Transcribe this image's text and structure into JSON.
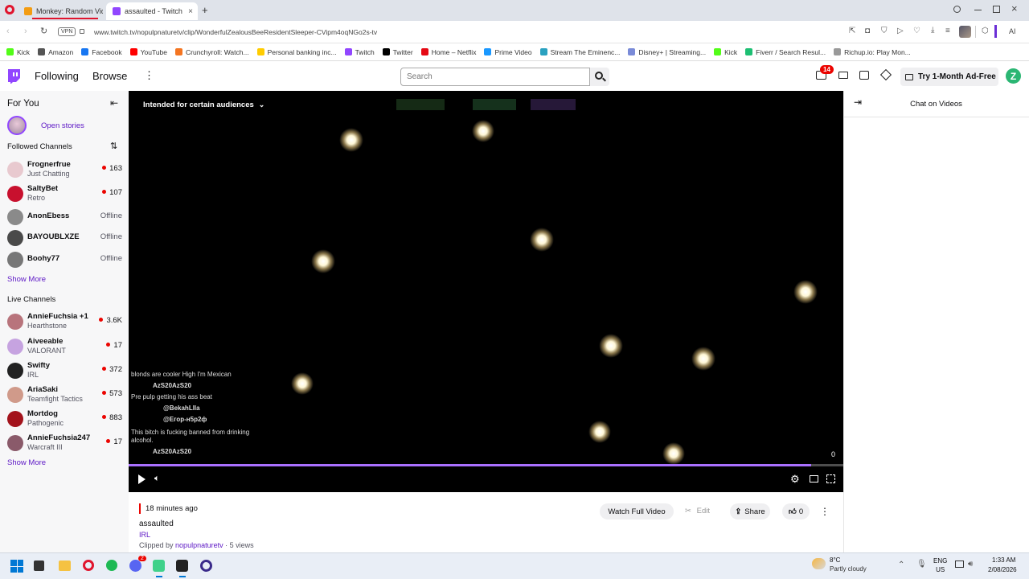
{
  "browser": {
    "tabs": [
      {
        "label": "Monkey: Random Vid"
      },
      {
        "label": "assaulted - Twitch"
      }
    ],
    "new_tab": "+",
    "url": "www.twitch.tv/nopulpnaturetv/clip/WonderfulZealousBeeResidentSleeper-CVipm4oqNGo2s-tv",
    "vpn": "VPN",
    "ai": "AI",
    "bookmarks": [
      {
        "label": "Kick",
        "color": "#53fc18"
      },
      {
        "label": "Amazon",
        "color": "#555555"
      },
      {
        "label": "Facebook",
        "color": "#1877f2"
      },
      {
        "label": "YouTube",
        "color": "#ff0000"
      },
      {
        "label": "Crunchyroll: Watch...",
        "color": "#f47521"
      },
      {
        "label": "Personal banking inc...",
        "color": "#ffcc00"
      },
      {
        "label": "Twitch",
        "color": "#9146ff"
      },
      {
        "label": "Twitter",
        "color": "#000000"
      },
      {
        "label": "Home – Netflix",
        "color": "#e50914"
      },
      {
        "label": "Prime Video",
        "color": "#1a98ff"
      },
      {
        "label": "Stream The Eminenc...",
        "color": "#2aa1c0"
      },
      {
        "label": "Disney+ | Streaming...",
        "color": "#7a8bd8"
      },
      {
        "label": "Kick",
        "color": "#53fc18"
      },
      {
        "label": "Fiverr / Search Resul...",
        "color": "#1dbf73"
      },
      {
        "label": "Richup.io: Play Mon...",
        "color": "#999999"
      }
    ]
  },
  "header": {
    "following": "Following",
    "browse": "Browse",
    "search_placeholder": "Search",
    "notif_count": "14",
    "ad_free": "Try 1-Month Ad-Free",
    "user_initial": "Z"
  },
  "sidebar": {
    "for_you": "For You",
    "open_stories": "Open stories",
    "followed_title": "Followed Channels",
    "followed": [
      {
        "name": "Frognerfrue",
        "game": "Just Chatting",
        "viewers": "163",
        "live": true,
        "color": "#e8c9cf"
      },
      {
        "name": "SaltyBet",
        "game": "Retro",
        "viewers": "107",
        "live": true,
        "color": "#c8102e"
      },
      {
        "name": "AnonEbess",
        "game": "",
        "viewers": "Offline",
        "live": false,
        "color": "#8a8a8a"
      },
      {
        "name": "BAYOUBLXZE",
        "game": "",
        "viewers": "Offline",
        "live": false,
        "color": "#4a4a4a"
      },
      {
        "name": "Boohy77",
        "game": "",
        "viewers": "Offline",
        "live": false,
        "color": "#777777"
      }
    ],
    "show_more_1": "Show More",
    "live_title": "Live Channels",
    "live": [
      {
        "name": "AnnieFuchsia +1",
        "game": "Hearthstone",
        "viewers": "3.6K",
        "color": "#b8747c"
      },
      {
        "name": "Aiveeable",
        "game": "VALORANT",
        "viewers": "17",
        "color": "#c6a3e0"
      },
      {
        "name": "Swifty",
        "game": "IRL",
        "viewers": "372",
        "color": "#222222"
      },
      {
        "name": "AriaSaki",
        "game": "Teamfight Tactics",
        "viewers": "573",
        "color": "#d09a8a"
      },
      {
        "name": "Mortdog",
        "game": "Pathogenic",
        "viewers": "883",
        "color": "#a3131c"
      },
      {
        "name": "AnnieFuchsia247",
        "game": "Warcraft III",
        "viewers": "17",
        "color": "#8a5a6a"
      }
    ],
    "show_more_2": "Show More"
  },
  "player": {
    "audience": "Intended for certain audiences",
    "overlay_chat": [
      "blonds are cooler High I'm Mexican",
      "AzS20AzS20",
      "Pre pulp getting his ass beat",
      "@BekahLlla",
      "@Егор-н5р2ф",
      "This bitch is fucking banned from drinking",
      "alcohol.",
      "AzS20AzS20"
    ],
    "time_counter": "0",
    "progress": 0.955
  },
  "clip": {
    "time_ago": "18 minutes ago",
    "title": "assaulted",
    "category": "IRL",
    "clipped_by_prefix": "Clipped by",
    "clipper": "nopulpnaturetv",
    "views": "· 5 views",
    "watch_full": "Watch Full Video",
    "edit": "Edit",
    "share": "Share",
    "likes": "0"
  },
  "chat": {
    "title": "Chat on Videos"
  },
  "taskbar": {
    "temp": "8°C",
    "weather": "Partly cloudy",
    "lang1": "ENG",
    "lang2": "US",
    "time": "1:33 AM",
    "date": "2/08/2026",
    "discord_badge": "2"
  }
}
